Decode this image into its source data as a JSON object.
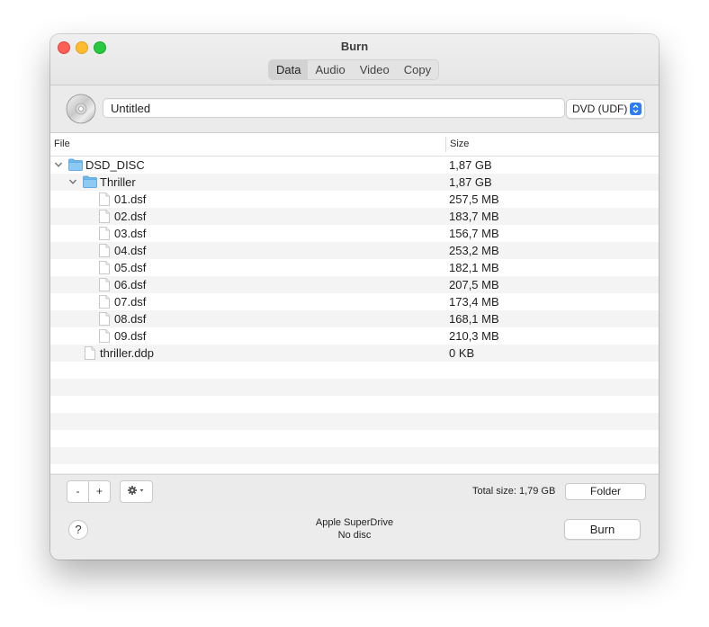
{
  "window": {
    "title": "Burn"
  },
  "tabs": [
    {
      "label": "Data",
      "active": true
    },
    {
      "label": "Audio",
      "active": false
    },
    {
      "label": "Video",
      "active": false
    },
    {
      "label": "Copy",
      "active": false
    }
  ],
  "toolbar": {
    "disc_name": "Untitled",
    "format": "DVD (UDF)"
  },
  "table": {
    "columns": [
      "File",
      "Size"
    ],
    "rows": [
      {
        "name": "DSD_DISC",
        "size": "1,87 GB",
        "kind": "folder",
        "level": 0,
        "expanded": true
      },
      {
        "name": "Thriller",
        "size": "1,87 GB",
        "kind": "folder",
        "level": 1,
        "expanded": true
      },
      {
        "name": "01.dsf",
        "size": "257,5 MB",
        "kind": "file",
        "level": 2
      },
      {
        "name": "02.dsf",
        "size": "183,7 MB",
        "kind": "file",
        "level": 2
      },
      {
        "name": "03.dsf",
        "size": "156,7 MB",
        "kind": "file",
        "level": 2
      },
      {
        "name": "04.dsf",
        "size": "253,2 MB",
        "kind": "file",
        "level": 2
      },
      {
        "name": "05.dsf",
        "size": "182,1 MB",
        "kind": "file",
        "level": 2
      },
      {
        "name": "06.dsf",
        "size": "207,5 MB",
        "kind": "file",
        "level": 2
      },
      {
        "name": "07.dsf",
        "size": "173,4 MB",
        "kind": "file",
        "level": 2
      },
      {
        "name": "08.dsf",
        "size": "168,1 MB",
        "kind": "file",
        "level": 2
      },
      {
        "name": "09.dsf",
        "size": "210,3 MB",
        "kind": "file",
        "level": 2
      },
      {
        "name": "thriller.ddp",
        "size": "0 KB",
        "kind": "file",
        "level": 1
      }
    ]
  },
  "bottom_bar": {
    "remove_label": "-",
    "add_label": "+",
    "action_icon": "gear-icon",
    "total_size": "Total size: 1,79 GB",
    "folder_label": "Folder"
  },
  "footer": {
    "help_label": "?",
    "drive_name": "Apple SuperDrive",
    "disc_status": "No disc",
    "burn_label": "Burn"
  },
  "colors": {
    "accent": "#2d7cf6",
    "folder": "#6db8ee",
    "close": "#fe5f57",
    "minimize": "#febc2e",
    "maximize": "#28c840"
  }
}
